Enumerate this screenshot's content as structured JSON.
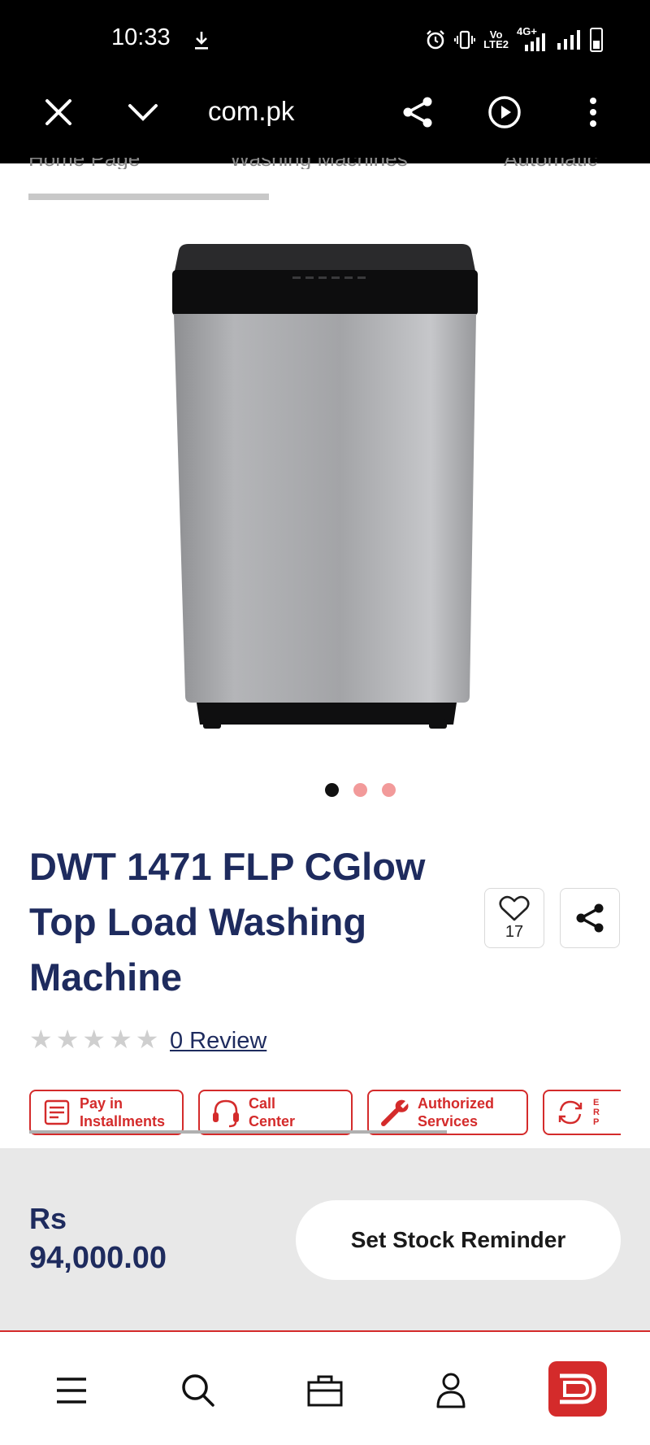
{
  "status_bar": {
    "time": "10:33",
    "network_line1": "Vo",
    "network_line2": "LTE2",
    "network_type": "4G+"
  },
  "browser_toolbar": {
    "url": "com.pk"
  },
  "breadcrumb_tabs": [
    "Home Page",
    "Washing Machines",
    "Automatic"
  ],
  "carousel": {
    "slide_count": 3,
    "active_index": 0,
    "image_alt": "washing machine product image"
  },
  "product": {
    "title": "DWT 1471 FLP CGlow Top Load Washing Machine",
    "favorite_count": "17",
    "rating_stars": 0,
    "rating_max": 5,
    "review_link": "0 Review"
  },
  "features": [
    {
      "label": "Pay in\nInstallments",
      "icon": "installments-icon"
    },
    {
      "label": "Call\nCenter",
      "icon": "headset-icon"
    },
    {
      "label": "Authorized\nServices",
      "icon": "wrench-icon"
    },
    {
      "label": "E\nR\nP",
      "icon": "refresh-icon"
    }
  ],
  "buy_bar": {
    "currency": "Rs",
    "price": "94,000.00",
    "reminder_button": "Set Stock Reminder"
  },
  "colors": {
    "brand_red": "#d42b2b",
    "title_navy": "#1e2b5e",
    "dot_inactive": "#f29a9a"
  },
  "bottom_nav": [
    "menu-icon",
    "search-icon",
    "briefcase-icon",
    "user-icon",
    "brand-logo"
  ]
}
